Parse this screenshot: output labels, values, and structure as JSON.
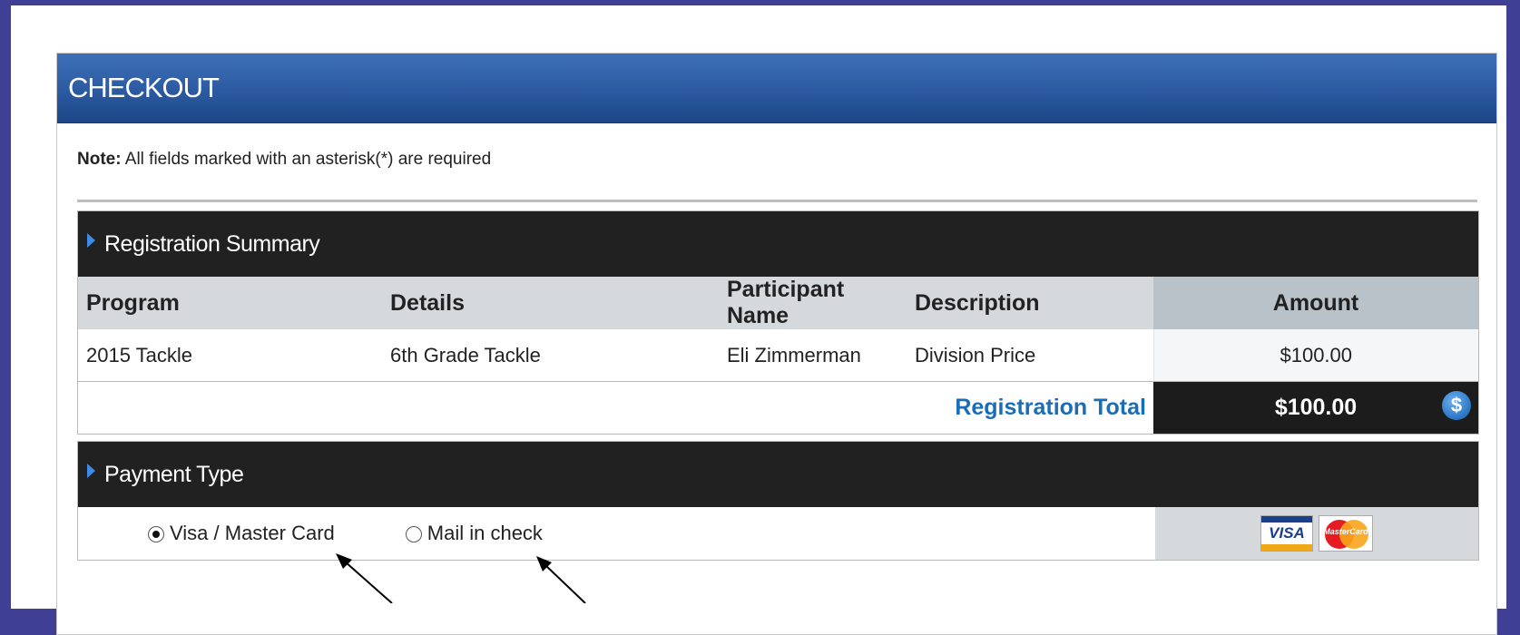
{
  "header": {
    "title": "CHECKOUT"
  },
  "note": {
    "label": "Note:",
    "text": " All fields marked with an asterisk(*) are required"
  },
  "summary": {
    "title": "Registration Summary",
    "columns": [
      "Program",
      "Details",
      "Participant Name",
      "Description",
      "Amount"
    ],
    "rows": [
      {
        "program": "2015 Tackle",
        "details": "6th Grade Tackle",
        "participant": "Eli Zimmerman",
        "description": "Division Price",
        "amount": "$100.00"
      }
    ],
    "total_label": "Registration Total",
    "total_amount": "$100.00",
    "total_icon": "$"
  },
  "payment": {
    "title": "Payment Type",
    "options": [
      {
        "label": "Visa / Master Card",
        "selected": true
      },
      {
        "label": "Mail in check",
        "selected": false
      }
    ],
    "visa_text": "VISA",
    "mastercard_text": "MasterCard"
  },
  "colors": {
    "header_blue": "#2b5aa0",
    "total_blue": "#1a6db6",
    "dark_bar": "#212121"
  }
}
